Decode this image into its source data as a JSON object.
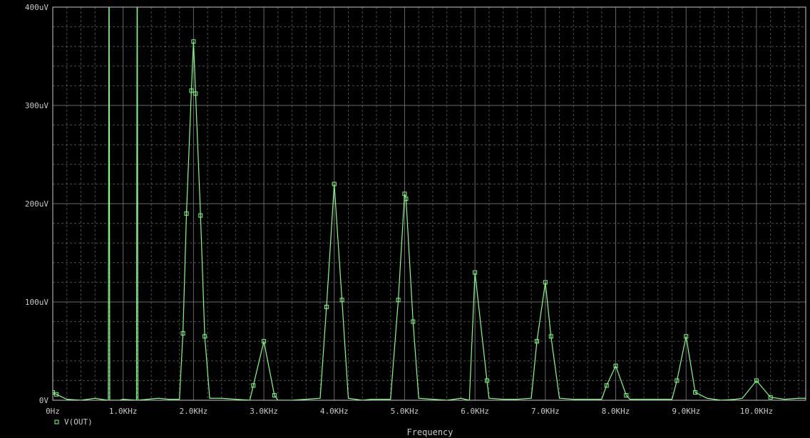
{
  "chart_data": {
    "type": "line",
    "title": "",
    "xlabel": "Frequency",
    "ylabel": "",
    "xlim": [
      0,
      10.7
    ],
    "ylim": [
      0,
      400
    ],
    "x_unit": "KHz",
    "y_unit": "uV",
    "grid": true,
    "grid_style": "dashed",
    "background": "#000000",
    "grid_color": "#8a8a8a",
    "x_ticks": [
      {
        "value": 0,
        "label": "0Hz"
      },
      {
        "value": 1,
        "label": "1.0KHz"
      },
      {
        "value": 2,
        "label": "2.0KHz"
      },
      {
        "value": 3,
        "label": "3.0KHz"
      },
      {
        "value": 4,
        "label": "4.0KHz"
      },
      {
        "value": 5,
        "label": "5.0KHz"
      },
      {
        "value": 6,
        "label": "6.0KHz"
      },
      {
        "value": 7,
        "label": "7.0KHz"
      },
      {
        "value": 8,
        "label": "8.0KHz"
      },
      {
        "value": 9,
        "label": "9.0KHz"
      },
      {
        "value": 10,
        "label": "10.0KHz"
      }
    ],
    "y_ticks": [
      {
        "value": 0,
        "label": "0V"
      },
      {
        "value": 100,
        "label": "100uV"
      },
      {
        "value": 200,
        "label": "200uV"
      },
      {
        "value": 300,
        "label": "300uV"
      },
      {
        "value": 400,
        "label": "400uV"
      }
    ],
    "series": [
      {
        "name": "V(OUT)",
        "color": "#7fff7f",
        "marker": "square",
        "points": [
          [
            0.0,
            8
          ],
          [
            0.05,
            6
          ],
          [
            0.2,
            1
          ],
          [
            0.4,
            0
          ],
          [
            0.6,
            2
          ],
          [
            0.78,
            0
          ],
          [
            0.79,
            0
          ],
          [
            0.8,
            500
          ],
          [
            0.81,
            0
          ],
          [
            0.95,
            0
          ],
          [
            1.0,
            1
          ],
          [
            1.18,
            0
          ],
          [
            1.19,
            0
          ],
          [
            1.2,
            500
          ],
          [
            1.21,
            0
          ],
          [
            1.35,
            1
          ],
          [
            1.5,
            2
          ],
          [
            1.65,
            1
          ],
          [
            1.8,
            1
          ],
          [
            1.85,
            68
          ],
          [
            1.9,
            190
          ],
          [
            1.97,
            315
          ],
          [
            2.0,
            365
          ],
          [
            2.03,
            312
          ],
          [
            2.1,
            188
          ],
          [
            2.16,
            65
          ],
          [
            2.23,
            2
          ],
          [
            2.4,
            2
          ],
          [
            2.6,
            1
          ],
          [
            2.8,
            0
          ],
          [
            2.85,
            15
          ],
          [
            3.0,
            60
          ],
          [
            3.15,
            5
          ],
          [
            3.2,
            0
          ],
          [
            3.4,
            0
          ],
          [
            3.6,
            1
          ],
          [
            3.8,
            2
          ],
          [
            3.89,
            95
          ],
          [
            4.0,
            220
          ],
          [
            4.11,
            102
          ],
          [
            4.2,
            2
          ],
          [
            4.4,
            0
          ],
          [
            4.53,
            1
          ],
          [
            4.8,
            1
          ],
          [
            4.91,
            102
          ],
          [
            5.0,
            210
          ],
          [
            5.02,
            205
          ],
          [
            5.12,
            80
          ],
          [
            5.2,
            2
          ],
          [
            5.4,
            1
          ],
          [
            5.6,
            0
          ],
          [
            5.8,
            2
          ],
          [
            5.92,
            0
          ],
          [
            6.0,
            130
          ],
          [
            6.17,
            20
          ],
          [
            6.2,
            2
          ],
          [
            6.4,
            1
          ],
          [
            6.6,
            1
          ],
          [
            6.8,
            2
          ],
          [
            6.88,
            60
          ],
          [
            7.0,
            120
          ],
          [
            7.08,
            65
          ],
          [
            7.2,
            2
          ],
          [
            7.4,
            1
          ],
          [
            7.6,
            1
          ],
          [
            7.8,
            1
          ],
          [
            7.87,
            15
          ],
          [
            8.0,
            35
          ],
          [
            8.15,
            5
          ],
          [
            8.2,
            1
          ],
          [
            8.4,
            1
          ],
          [
            8.6,
            1
          ],
          [
            8.8,
            1
          ],
          [
            8.87,
            20
          ],
          [
            9.0,
            65
          ],
          [
            9.13,
            8
          ],
          [
            9.3,
            2
          ],
          [
            9.4,
            1
          ],
          [
            9.5,
            0
          ],
          [
            9.7,
            1
          ],
          [
            9.8,
            2
          ],
          [
            10.0,
            20
          ],
          [
            10.2,
            3
          ],
          [
            10.4,
            1
          ],
          [
            10.6,
            2
          ],
          [
            10.7,
            2
          ]
        ]
      }
    ],
    "legend": {
      "position": "bottom-left",
      "entries": [
        "V(OUT)"
      ]
    }
  }
}
